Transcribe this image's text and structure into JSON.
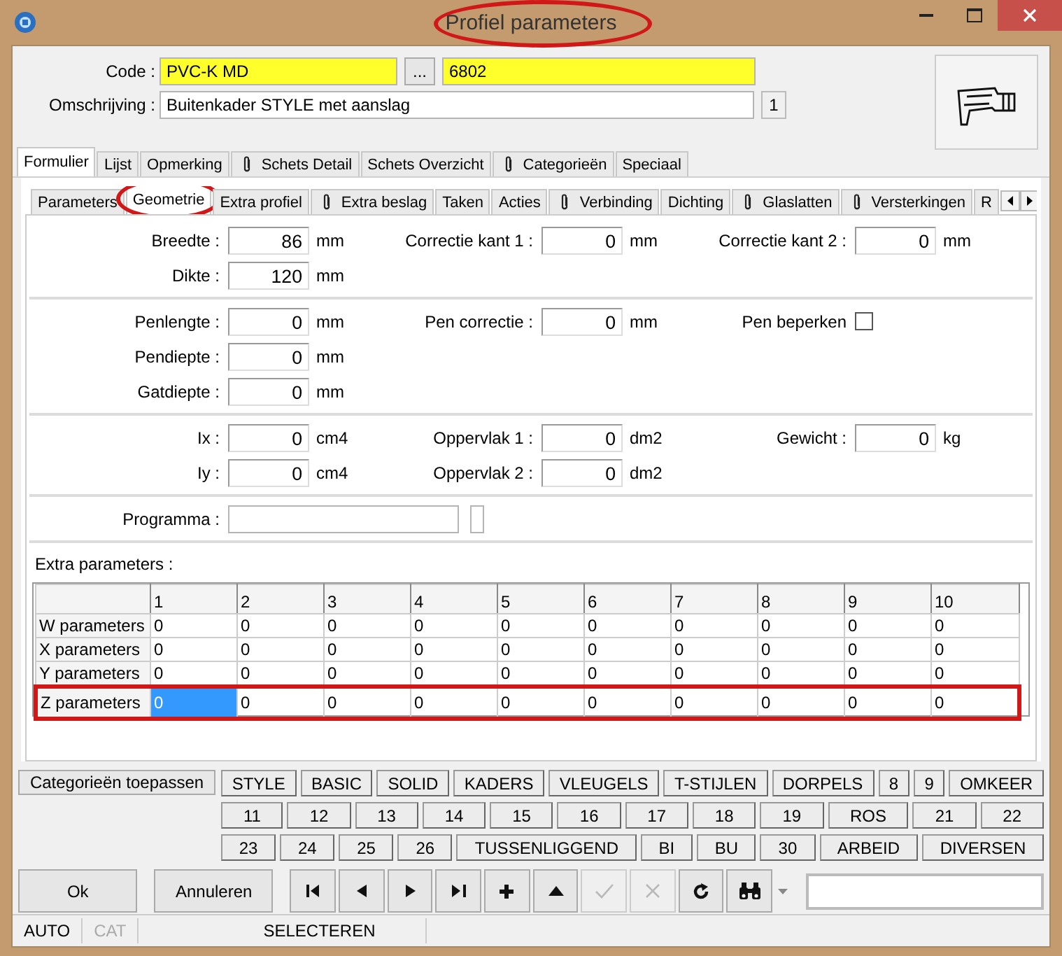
{
  "window": {
    "title": "Profiel parameters",
    "highlighted": true
  },
  "header": {
    "code_label": "Code :",
    "code": "PVC-K MD",
    "browse": "...",
    "number": "6802",
    "description_label": "Omschrijving :",
    "description": "Buitenkader STYLE met aanslag",
    "count": "1"
  },
  "tabs": [
    {
      "label": "Formulier",
      "selected": true,
      "attachment": false
    },
    {
      "label": "Lijst",
      "selected": false,
      "attachment": false
    },
    {
      "label": "Opmerking",
      "selected": false,
      "attachment": false
    },
    {
      "label": "Schets Detail",
      "selected": false,
      "attachment": true
    },
    {
      "label": "Schets Overzicht",
      "selected": false,
      "attachment": false
    },
    {
      "label": "Categorieën",
      "selected": false,
      "attachment": true
    },
    {
      "label": "Speciaal",
      "selected": false,
      "attachment": false
    }
  ],
  "subtabs": [
    {
      "label": "Parameters",
      "selected": false,
      "attachment": false,
      "highlighted": false
    },
    {
      "label": "Geometrie",
      "selected": true,
      "attachment": false,
      "highlighted": true
    },
    {
      "label": "Extra profiel",
      "selected": false,
      "attachment": false,
      "highlighted": false
    },
    {
      "label": "Extra beslag",
      "selected": false,
      "attachment": true,
      "highlighted": false
    },
    {
      "label": "Taken",
      "selected": false,
      "attachment": false,
      "highlighted": false
    },
    {
      "label": "Acties",
      "selected": false,
      "attachment": false,
      "highlighted": false
    },
    {
      "label": "Verbinding",
      "selected": false,
      "attachment": true,
      "highlighted": false
    },
    {
      "label": "Dichting",
      "selected": false,
      "attachment": false,
      "highlighted": false
    },
    {
      "label": "Glaslatten",
      "selected": false,
      "attachment": true,
      "highlighted": false
    },
    {
      "label": "Versterkingen",
      "selected": false,
      "attachment": true,
      "highlighted": false
    },
    {
      "label": "R",
      "selected": false,
      "attachment": false,
      "highlighted": false
    }
  ],
  "groups": [
    {
      "columns": [
        [
          {
            "kind": "number",
            "label": "Breedte :",
            "value": "86",
            "unit": "mm"
          },
          {
            "kind": "number",
            "label": "Dikte :",
            "value": "120",
            "unit": "mm"
          }
        ],
        [
          {
            "kind": "number",
            "label": "Correctie kant 1 :",
            "value": "0",
            "unit": "mm"
          }
        ],
        [
          {
            "kind": "number",
            "label": "Correctie kant 2 :",
            "value": "0",
            "unit": "mm"
          }
        ]
      ]
    },
    {
      "columns": [
        [
          {
            "kind": "number",
            "label": "Penlengte :",
            "value": "0",
            "unit": "mm"
          },
          {
            "kind": "number",
            "label": "Pendiepte :",
            "value": "0",
            "unit": "mm"
          },
          {
            "kind": "number",
            "label": "Gatdiepte :",
            "value": "0",
            "unit": "mm"
          }
        ],
        [
          {
            "kind": "number",
            "label": "Pen correctie :",
            "value": "0",
            "unit": "mm"
          }
        ],
        [
          {
            "kind": "checkbox",
            "label": "Pen beperken",
            "checked": false
          }
        ]
      ]
    },
    {
      "columns": [
        [
          {
            "kind": "number",
            "label": "Ix :",
            "value": "0",
            "unit": "cm4"
          },
          {
            "kind": "number",
            "label": "Iy :",
            "value": "0",
            "unit": "cm4"
          }
        ],
        [
          {
            "kind": "number",
            "label": "Oppervlak 1 :",
            "value": "0",
            "unit": "dm2"
          },
          {
            "kind": "number",
            "label": "Oppervlak 2 :",
            "value": "0",
            "unit": "dm2"
          }
        ],
        [
          {
            "kind": "number",
            "label": "Gewicht :",
            "value": "0",
            "unit": "kg"
          }
        ]
      ]
    },
    {
      "columns": [
        [
          {
            "kind": "program",
            "label": "Programma :"
          }
        ]
      ]
    }
  ],
  "extra_parameters": {
    "label": "Extra parameters :",
    "columns": [
      "1",
      "2",
      "3",
      "4",
      "5",
      "6",
      "7",
      "8",
      "9",
      "10"
    ],
    "rows": [
      {
        "label": "W parameters",
        "highlighted": false,
        "cells": [
          {
            "value": "0",
            "selected": false
          },
          {
            "value": "0",
            "selected": false
          },
          {
            "value": "0",
            "selected": false
          },
          {
            "value": "0",
            "selected": false
          },
          {
            "value": "0",
            "selected": false
          },
          {
            "value": "0",
            "selected": false
          },
          {
            "value": "0",
            "selected": false
          },
          {
            "value": "0",
            "selected": false
          },
          {
            "value": "0",
            "selected": false
          },
          {
            "value": "0",
            "selected": false
          }
        ]
      },
      {
        "label": "X parameters",
        "highlighted": false,
        "cells": [
          {
            "value": "0",
            "selected": false
          },
          {
            "value": "0",
            "selected": false
          },
          {
            "value": "0",
            "selected": false
          },
          {
            "value": "0",
            "selected": false
          },
          {
            "value": "0",
            "selected": false
          },
          {
            "value": "0",
            "selected": false
          },
          {
            "value": "0",
            "selected": false
          },
          {
            "value": "0",
            "selected": false
          },
          {
            "value": "0",
            "selected": false
          },
          {
            "value": "0",
            "selected": false
          }
        ]
      },
      {
        "label": "Y parameters",
        "highlighted": false,
        "cells": [
          {
            "value": "0",
            "selected": false
          },
          {
            "value": "0",
            "selected": false
          },
          {
            "value": "0",
            "selected": false
          },
          {
            "value": "0",
            "selected": false
          },
          {
            "value": "0",
            "selected": false
          },
          {
            "value": "0",
            "selected": false
          },
          {
            "value": "0",
            "selected": false
          },
          {
            "value": "0",
            "selected": false
          },
          {
            "value": "0",
            "selected": false
          },
          {
            "value": "0",
            "selected": false
          }
        ]
      },
      {
        "label": "Z parameters",
        "highlighted": true,
        "cells": [
          {
            "value": "0",
            "selected": true
          },
          {
            "value": "0",
            "selected": false
          },
          {
            "value": "0",
            "selected": false
          },
          {
            "value": "0",
            "selected": false
          },
          {
            "value": "0",
            "selected": false
          },
          {
            "value": "0",
            "selected": false
          },
          {
            "value": "0",
            "selected": false
          },
          {
            "value": "0",
            "selected": false
          },
          {
            "value": "0",
            "selected": false
          },
          {
            "value": "0",
            "selected": false
          }
        ]
      }
    ]
  },
  "categories": {
    "apply": "Categorieën toepassen",
    "lines": [
      {
        "buttons": [
          "STYLE",
          "BASIC",
          "SOLID",
          "KADERS",
          "VLEUGELS",
          "T-STIJLEN",
          "DORPELS",
          "8",
          "9",
          "OMKEER"
        ]
      },
      {
        "buttons": [
          "11",
          "12",
          "13",
          "14",
          "15",
          "16",
          "17",
          "18",
          "19",
          "ROS",
          "21",
          "22"
        ]
      },
      {
        "buttons": [
          "23",
          "24",
          "25",
          "26",
          "TUSSENLIGGEND",
          "BI",
          "BU",
          "30",
          "ARBEID",
          "DIVERSEN"
        ]
      }
    ]
  },
  "actions": [
    {
      "label": "Ok"
    },
    {
      "label": "Annuleren"
    }
  ],
  "navigation": [
    {
      "kind": "first",
      "disabled": false
    },
    {
      "kind": "previous",
      "disabled": false
    },
    {
      "kind": "next",
      "disabled": false
    },
    {
      "kind": "last",
      "disabled": false
    },
    {
      "kind": "add",
      "disabled": false
    },
    {
      "kind": "up",
      "disabled": false
    },
    {
      "kind": "confirm",
      "disabled": true
    },
    {
      "kind": "cancel",
      "disabled": true
    },
    {
      "kind": "refresh",
      "disabled": false
    },
    {
      "kind": "find",
      "disabled": false
    }
  ],
  "status_bar": [
    {
      "label": "AUTO",
      "disabled": false
    },
    {
      "label": "CAT",
      "disabled": true
    },
    {
      "label": "SELECTEREN",
      "disabled": false
    }
  ]
}
